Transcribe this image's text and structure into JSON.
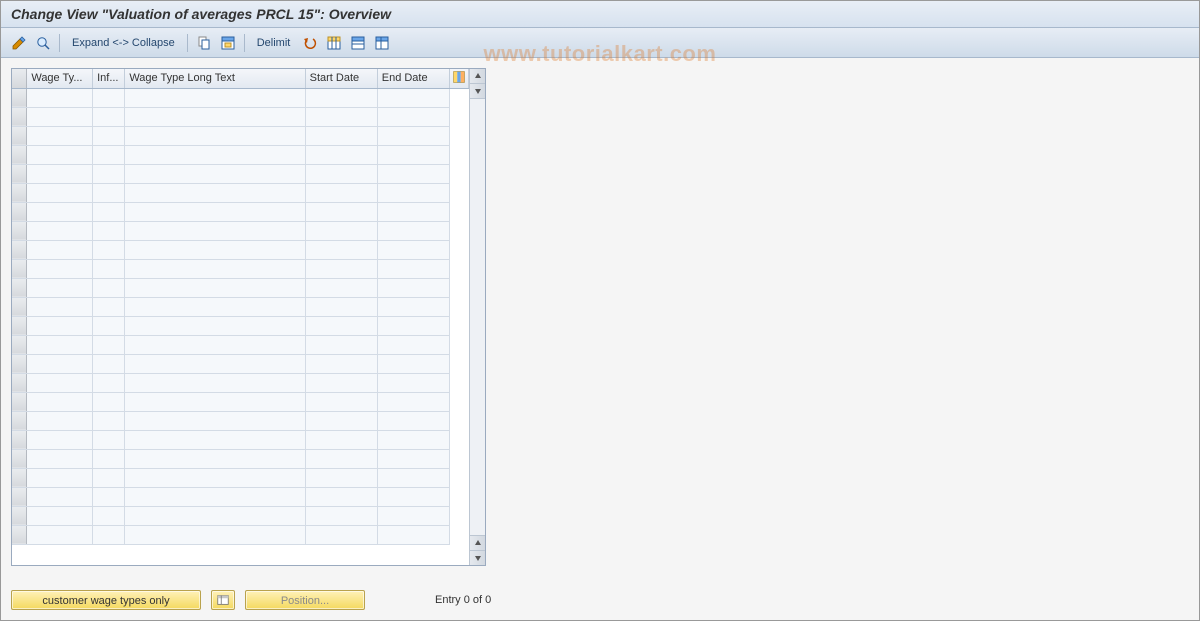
{
  "title": "Change View \"Valuation of averages PRCL 15\": Overview",
  "watermark": "www.tutorialkart.com",
  "toolbar": {
    "expand_collapse": "Expand <-> Collapse",
    "delimit": "Delimit"
  },
  "table": {
    "columns": {
      "wage_type": "Wage Ty...",
      "inf": "Inf...",
      "long_text": "Wage Type Long Text",
      "start_date": "Start Date",
      "end_date": "End Date"
    }
  },
  "footer": {
    "customer_wage_types": "customer wage types only",
    "position": "Position...",
    "entry_status": "Entry 0 of 0"
  }
}
